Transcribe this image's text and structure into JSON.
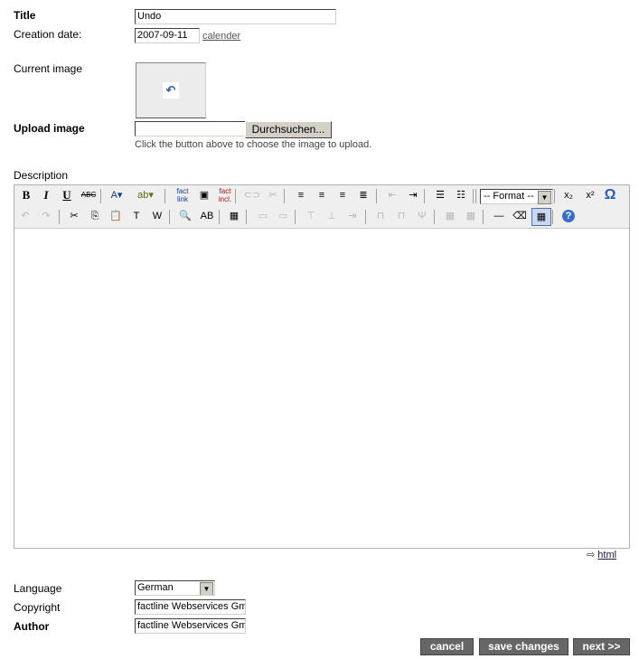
{
  "form": {
    "title_label": "Title",
    "title_value": "Undo",
    "date_label": "Creation date:",
    "date_value": "2007-09-11",
    "calendar_link": "calender",
    "current_image_label": "Current image",
    "upload_label": "Upload image",
    "browse_button": "Durchsuchen...",
    "upload_hint": "Click the button above to choose the image to upload.",
    "description_label": "Description",
    "language_label": "Language",
    "language_value": "German",
    "copyright_label": "Copyright",
    "copyright_value": "factline Webservices Gm",
    "author_label": "Author",
    "author_value": "factline Webservices Gm"
  },
  "editor": {
    "format_value": "-- Format --",
    "html_toggle": "html",
    "row1": [
      {
        "name": "bold",
        "glyph": "B"
      },
      {
        "name": "italic",
        "glyph": "I"
      },
      {
        "name": "underline",
        "glyph": "U"
      },
      {
        "name": "strikethrough",
        "glyph": "ABC"
      },
      {
        "name": "font-color",
        "glyph": "A▾"
      },
      {
        "name": "highlight-color",
        "glyph": "ab▾"
      },
      {
        "name": "fact-link",
        "glyph": "fact link"
      },
      {
        "name": "insert-image",
        "glyph": "▣"
      },
      {
        "name": "fact-include",
        "glyph": "fact incl."
      },
      {
        "name": "link",
        "glyph": "⊂⊃",
        "disabled": true
      },
      {
        "name": "unlink",
        "glyph": "✂",
        "disabled": true
      },
      {
        "name": "align-left",
        "glyph": "≡"
      },
      {
        "name": "align-center",
        "glyph": "≡"
      },
      {
        "name": "align-right",
        "glyph": "≡"
      },
      {
        "name": "justify",
        "glyph": "≣"
      },
      {
        "name": "outdent",
        "glyph": "⇤",
        "disabled": true
      },
      {
        "name": "indent",
        "glyph": "⇥"
      },
      {
        "name": "bullet-list",
        "glyph": "☰"
      },
      {
        "name": "numbered-list",
        "glyph": "☷"
      },
      {
        "name": "subscript",
        "glyph": "x₂"
      },
      {
        "name": "superscript",
        "glyph": "x²"
      },
      {
        "name": "special-char",
        "glyph": "Ω"
      }
    ],
    "row2": [
      {
        "name": "undo",
        "glyph": "↶",
        "disabled": true
      },
      {
        "name": "redo",
        "glyph": "↷",
        "disabled": true
      },
      {
        "name": "cut",
        "glyph": "✂"
      },
      {
        "name": "copy",
        "glyph": "⎘"
      },
      {
        "name": "paste",
        "glyph": "📋"
      },
      {
        "name": "paste-text",
        "glyph": "T"
      },
      {
        "name": "paste-word",
        "glyph": "W"
      },
      {
        "name": "find",
        "glyph": "🔍"
      },
      {
        "name": "replace",
        "glyph": "AB"
      },
      {
        "name": "table-edit",
        "glyph": "▦"
      },
      {
        "name": "merge-cells",
        "glyph": "▭",
        "disabled": true
      },
      {
        "name": "split-cell",
        "glyph": "▭",
        "disabled": true
      },
      {
        "name": "insert-row-before",
        "glyph": "⊤",
        "disabled": true
      },
      {
        "name": "insert-row-after",
        "glyph": "⊥",
        "disabled": true
      },
      {
        "name": "delete-row",
        "glyph": "⇥",
        "disabled": true
      },
      {
        "name": "insert-col-before",
        "glyph": "⊓",
        "disabled": true
      },
      {
        "name": "insert-col-after",
        "glyph": "⊓",
        "disabled": true
      },
      {
        "name": "delete-col",
        "glyph": "Ψ",
        "disabled": true
      },
      {
        "name": "table-props",
        "glyph": "▦",
        "disabled": true
      },
      {
        "name": "cell-props",
        "glyph": "▦",
        "disabled": true
      },
      {
        "name": "horizontal-rule",
        "glyph": "—"
      },
      {
        "name": "remove-format",
        "glyph": "⌫"
      },
      {
        "name": "toggle-guidelines",
        "glyph": "▦"
      },
      {
        "name": "help",
        "glyph": "?"
      }
    ]
  },
  "buttons": {
    "cancel": "cancel",
    "save": "save changes",
    "next": "next >>"
  },
  "colors": {
    "button_bg": "#666666",
    "toolbar_bg": "#efefef",
    "link": "#555555"
  }
}
